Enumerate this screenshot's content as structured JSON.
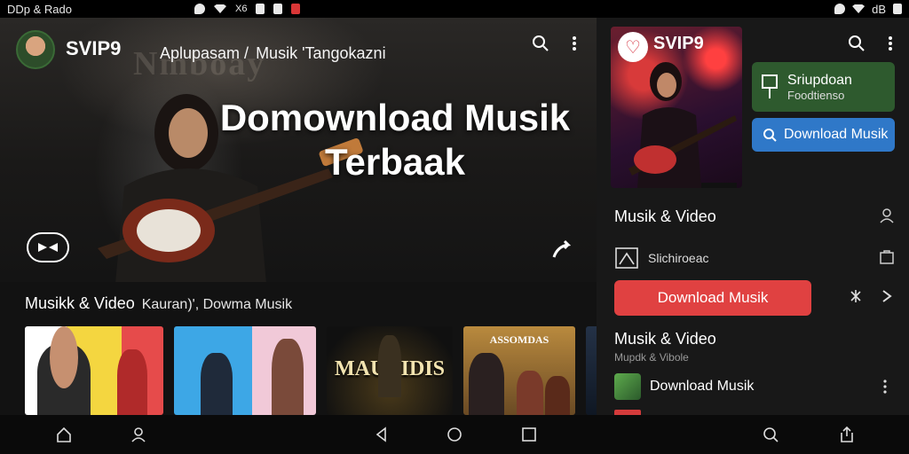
{
  "status": {
    "left_text": "DDp & Rado",
    "sim_text": "X6",
    "right_text": "dB"
  },
  "header": {
    "brand": "SVIP9",
    "nav_links": [
      "Aplupasam /",
      "Musik 'Tangokazni"
    ]
  },
  "hero": {
    "background_text": "Nmboay",
    "title_line1": "Domownload Musik",
    "title_line2": "Terbaak"
  },
  "section": {
    "title": "Musikk & Video",
    "subtitle": "Kauran)', Dowma Musik"
  },
  "thumbnails": [
    {
      "title": ""
    },
    {
      "title": ""
    },
    {
      "title": "MAUDIDIS"
    },
    {
      "title": "ASSOMDAS"
    },
    {
      "title": ""
    }
  ],
  "right_pane": {
    "cover_brand": "SVIP9",
    "green_button": {
      "line1": "Sriupdoan",
      "line2": "Foodtienso"
    },
    "blue_button_label": "Download Musik",
    "row1_label": "Musik & Video",
    "row2_label": "Slichiroeac",
    "red_button_label": "Download Musik",
    "row3_label": "Musik & Video",
    "row3_sub": "Mupdk & Vibole",
    "list_item_label": "Download Musik"
  },
  "colors": {
    "accent_red": "#e04141",
    "accent_blue": "#2f78c8",
    "accent_green": "#2e5a2e",
    "background": "#121212"
  },
  "icons": [
    "search-icon",
    "more-vert-icon",
    "play-icon",
    "share-icon",
    "person-icon",
    "bag-icon",
    "close-icon",
    "chevron-right-icon",
    "back-icon",
    "home-icon",
    "recents-icon",
    "nav-home-icon",
    "nav-profile-icon",
    "nav-search-icon",
    "nav-share-icon"
  ]
}
